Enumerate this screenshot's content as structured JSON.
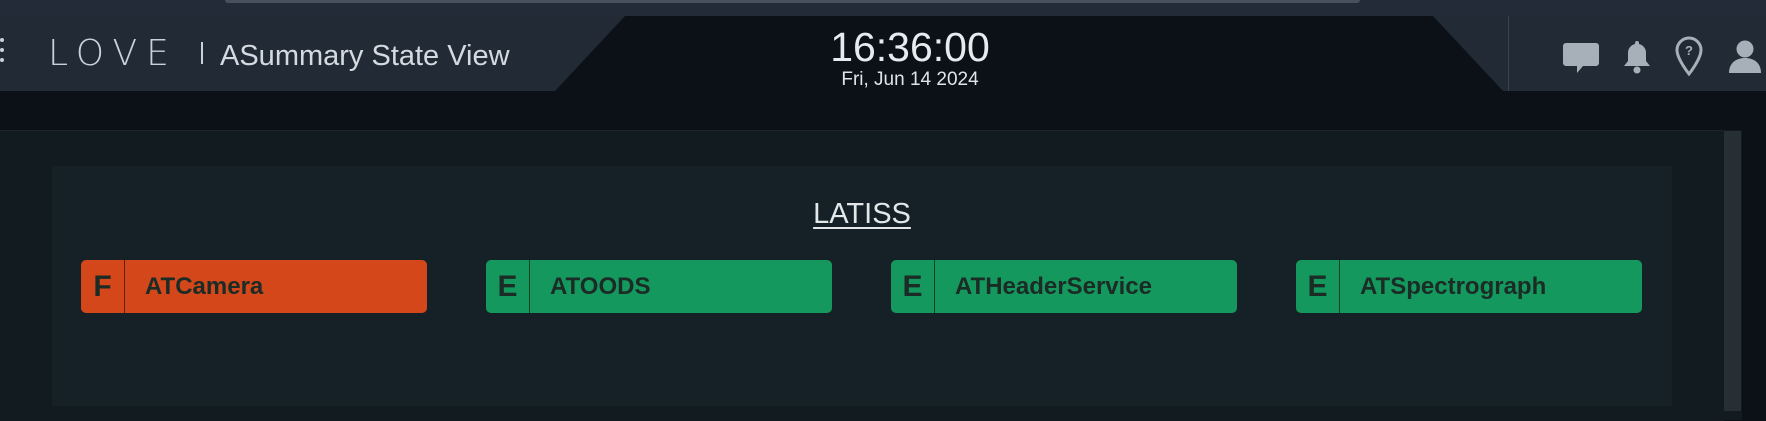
{
  "header": {
    "logo_text": "LOVE",
    "view_title": "ASummary State View",
    "time": "16:36:00",
    "date": "Fri, Jun 14 2024",
    "icons": [
      "chat-icon",
      "bell-icon",
      "location-pin-icon",
      "user-icon"
    ]
  },
  "group": {
    "title": "LATISS",
    "cscs": [
      {
        "state": "F",
        "name": "ATCamera",
        "color": "#d3471b"
      },
      {
        "state": "E",
        "name": "ATOODS",
        "color": "#15985e"
      },
      {
        "state": "E",
        "name": "ATHeaderService",
        "color": "#15985e"
      },
      {
        "state": "E",
        "name": "ATSpectrograph",
        "color": "#15985e"
      }
    ]
  },
  "colors": {
    "fault": "#d3471b",
    "enabled": "#15985e",
    "background": "#0b1117",
    "panel": "#222b35"
  }
}
